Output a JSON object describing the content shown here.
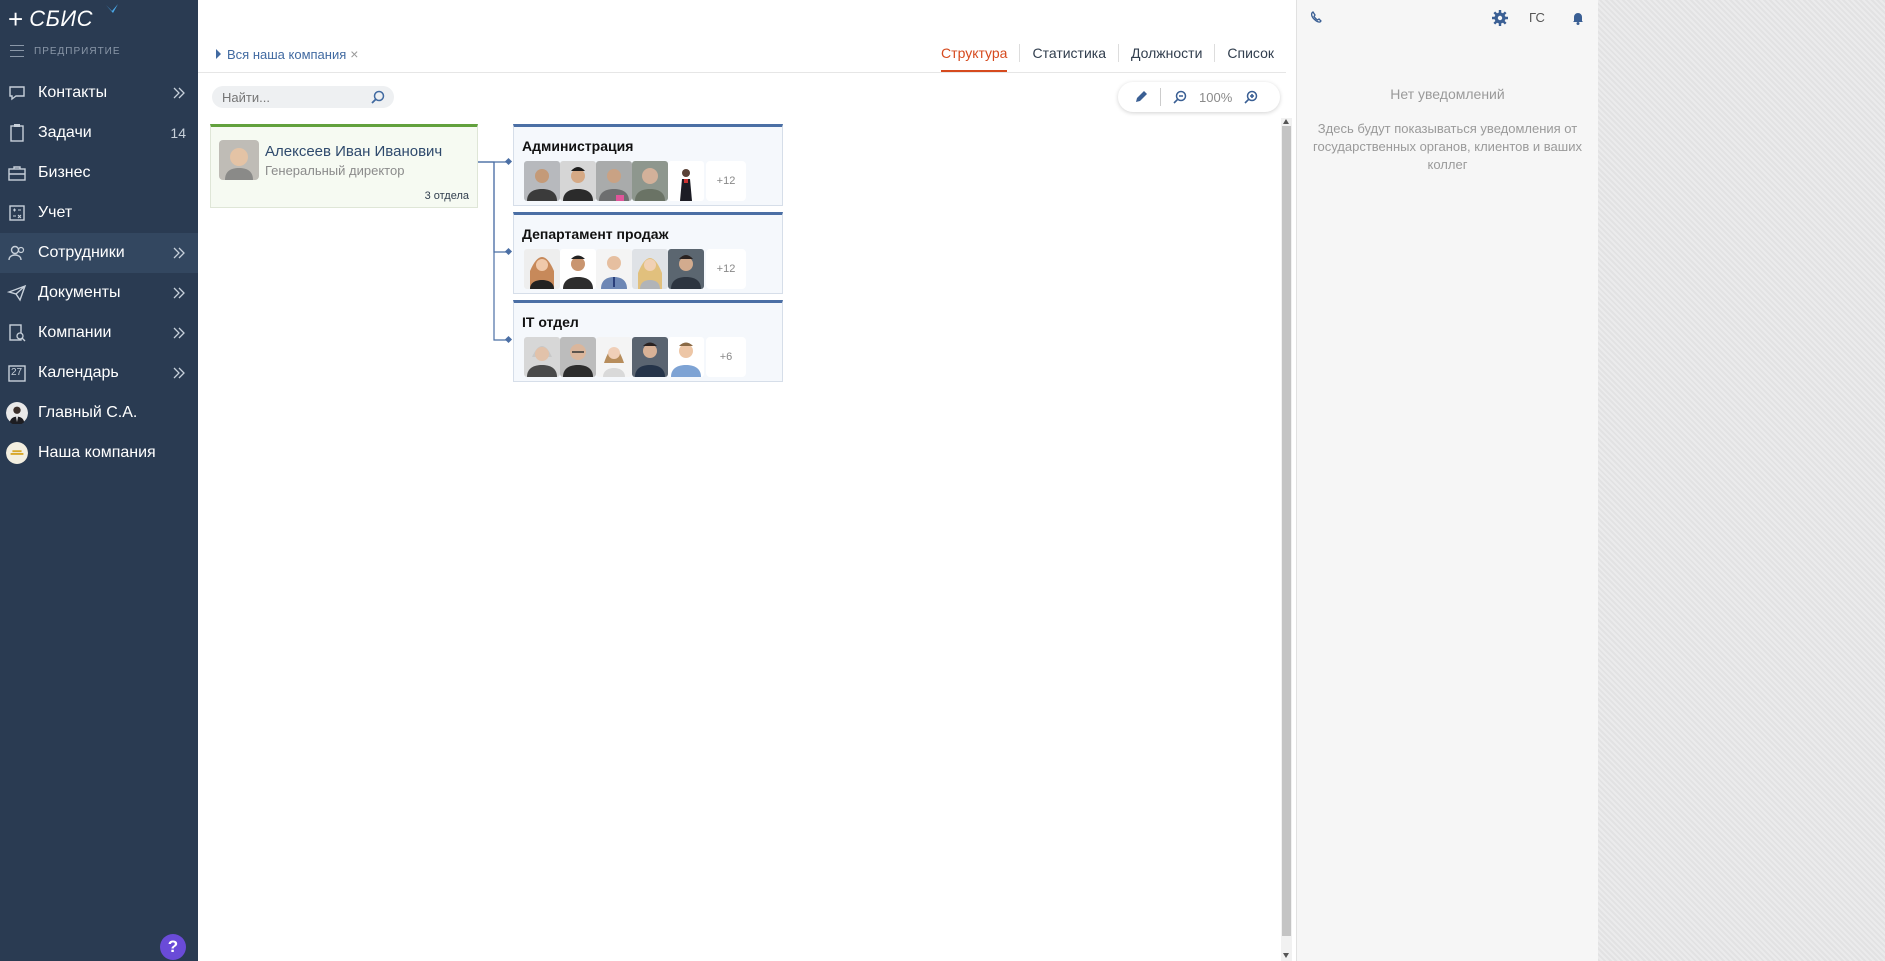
{
  "brand": {
    "logo_text": "СБИС",
    "section_label": "ПРЕДПРИЯТИЕ",
    "accent": "#4aa8e8"
  },
  "sidebar": {
    "items": [
      {
        "label": "Контакты",
        "icon": "chat-icon",
        "expand": true
      },
      {
        "label": "Задачи",
        "icon": "clipboard-icon",
        "badge": "14"
      },
      {
        "label": "Бизнес",
        "icon": "briefcase-icon"
      },
      {
        "label": "Учет",
        "icon": "calculator-icon"
      },
      {
        "label": "Сотрудники",
        "icon": "people-icon",
        "expand": true,
        "active": true
      },
      {
        "label": "Документы",
        "icon": "paper-plane-icon",
        "expand": true
      },
      {
        "label": "Компании",
        "icon": "company-search-icon",
        "expand": true
      },
      {
        "label": "Календарь",
        "icon": "calendar-icon",
        "calendar_day": "27",
        "expand": true
      },
      {
        "label": "Главный С.А.",
        "icon": "user-avatar"
      },
      {
        "label": "Наша компания",
        "icon": "company-logo"
      }
    ],
    "help_label": "?"
  },
  "breadcrumb": {
    "label": "Вся наша компания"
  },
  "tabs": [
    {
      "label": "Структура",
      "active": true
    },
    {
      "label": "Статистика"
    },
    {
      "label": "Должности"
    },
    {
      "label": "Список"
    }
  ],
  "search": {
    "placeholder": "Найти..."
  },
  "zoom": {
    "value": "100%"
  },
  "org": {
    "head": {
      "name": "Алексеев Иван Иванович",
      "role": "Генеральный директор",
      "count": "3 отдела"
    },
    "departments": [
      {
        "title": "Администрация",
        "more": "+12"
      },
      {
        "title": "Департамент продаж",
        "more": "+12"
      },
      {
        "title": "IT отдел",
        "more": "+6"
      }
    ]
  },
  "notifications": {
    "title": "Нет уведомлений",
    "text": "Здесь будут показываться уведомления от государственных органов, клиентов и ваших коллег",
    "gc_label": "ГС"
  },
  "colors": {
    "sidebar_bg": "#2a3b52",
    "active_tab": "#d64a1e",
    "dept_border": "#4b6fa5",
    "head_border": "#62a13d",
    "help_bg": "#6a4bd8"
  }
}
